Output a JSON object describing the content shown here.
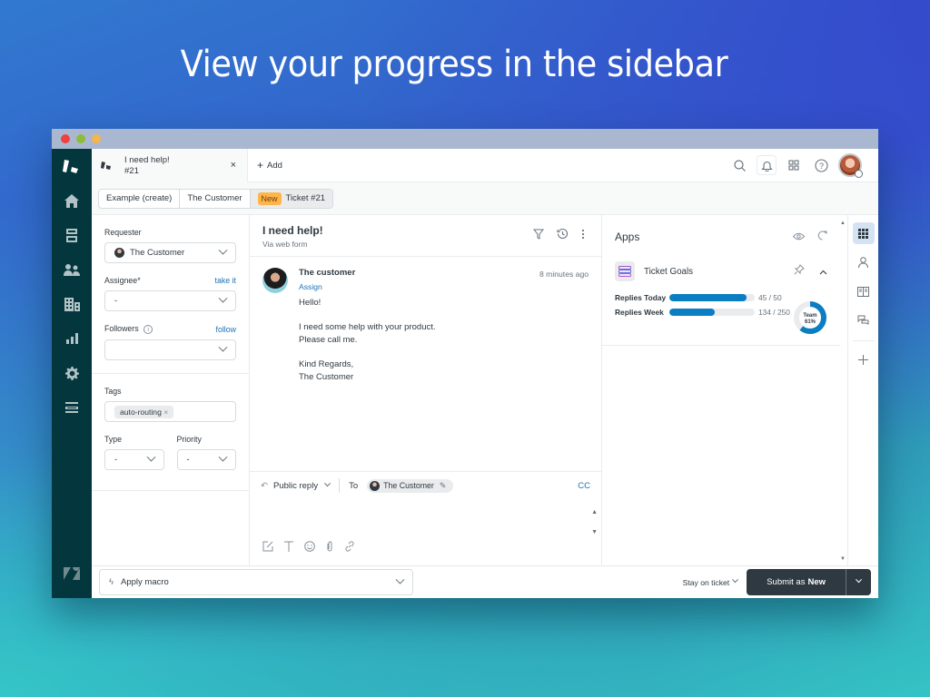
{
  "headline": "View your progress in the sidebar",
  "colors": {
    "nav_bg": "#03363d",
    "accent": "#1f73b7",
    "progress": "#0b7dc2",
    "new_badge": "#ffb648",
    "submit_bg": "#2f3941"
  },
  "tabs": [
    {
      "title": "I need help!",
      "subtitle": "#21",
      "close": "×"
    }
  ],
  "add_tab": "Add",
  "breadcrumb": {
    "items": [
      "Example (create)",
      "The Customer"
    ],
    "status_badge": "New",
    "ticket": "Ticket #21"
  },
  "left": {
    "requester_label": "Requester",
    "requester_value": "The Customer",
    "assignee_label": "Assignee*",
    "assignee_link": "take it",
    "assignee_value": "-",
    "followers_label": "Followers",
    "followers_link": "follow",
    "followers_value": "",
    "tags_label": "Tags",
    "tags": [
      "auto-routing"
    ],
    "type_label": "Type",
    "type_value": "-",
    "priority_label": "Priority",
    "priority_value": "-"
  },
  "conversation": {
    "title": "I need help!",
    "channel": "Via web form",
    "message": {
      "author": "The customer",
      "time": "8 minutes ago",
      "assign": "Assign",
      "body": "Hello!\n\nI need some help with your product.\nPlease call me.\n\nKind Regards,\nThe Customer"
    }
  },
  "composer": {
    "mode": "Public reply",
    "to_label": "To",
    "recipient": "The Customer",
    "cc": "CC"
  },
  "apps": {
    "title": "Apps",
    "ticket_goals": {
      "name": "Ticket Goals",
      "goals": [
        {
          "label": "Replies Today",
          "current": 45,
          "target": 50,
          "display": "45 / 50"
        },
        {
          "label": "Replies Week",
          "current": 134,
          "target": 250,
          "display": "134 / 250"
        }
      ],
      "team_label": "Team",
      "team_percent": 61,
      "team_display": "61%"
    }
  },
  "footer": {
    "macro_placeholder": "Apply macro",
    "stay": "Stay on ticket",
    "submit_prefix": "Submit as",
    "submit_status": "New"
  }
}
